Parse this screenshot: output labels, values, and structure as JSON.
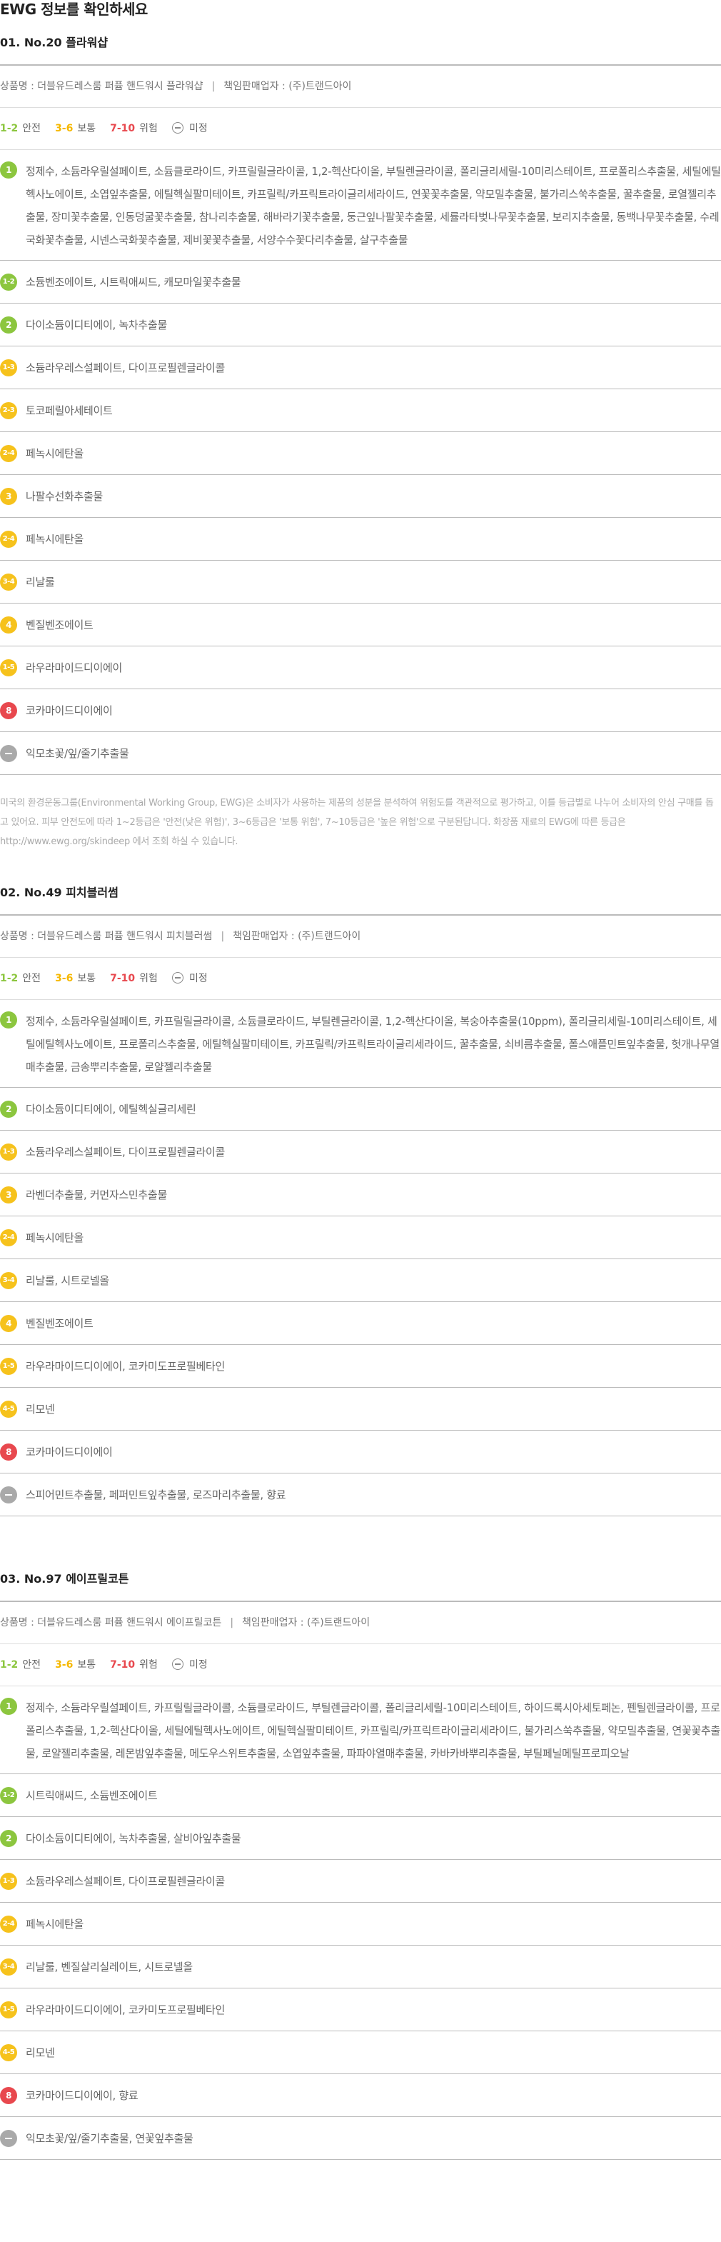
{
  "page": {
    "title": "EWG 정보를 확인하세요"
  },
  "legend": {
    "safe_range": "1-2",
    "safe_label": "안전",
    "normal_range": "3-6",
    "normal_label": "보통",
    "danger_range": "7-10",
    "danger_label": "위험",
    "unknown_label": "미정"
  },
  "colors": {
    "green": "#8cc63f",
    "yellow": "#f6c21c",
    "red": "#e8484e",
    "gray": "#a9a9a9"
  },
  "products": [
    {
      "title": "01. No.20 플라워샵",
      "product_name": "상품명 : 더블유드레스룸 퍼퓸 핸드워시 플라워샵",
      "seller": "책임판매업자 : (주)트랜드아이",
      "rows": [
        {
          "grade": "1",
          "color": "green",
          "text": "정제수, 소듐라우릴설페이트, 소듐클로라이드, 카프릴릴글라이콜, 1,2-헥산다이올, 부틸렌글라이콜, 폴리글리세릴-10미리스테이트, 프로폴리스추출물, 세틸에틸헥사노에이트, 소엽잎추출물, 에틸헥실팔미테이트, 카프릴릭/카프릭트라이글리세라이드, 연꽃꽃추출물, 약모밀추출물, 불가리스쑥추출물, 꿀추출물, 로열젤리추출물, 장미꽃추출물, 인동덩굴꽃추출물, 참나리추출물, 해바라기꽃추출물, 둥근잎나팔꽃추출물, 세률라타벚나무꽃추출물, 보리지추출물, 동백나무꽃추출물, 수레국화꽃추출물, 시넨스국화꽃추출물, 제비꽃꽃추출물, 서양수수꽃다리추출물, 살구추출물"
        },
        {
          "grade": "1-2",
          "color": "green",
          "text": "소듐벤조에이트, 시트릭애씨드, 캐모마일꽃추출물"
        },
        {
          "grade": "2",
          "color": "green",
          "text": "다이소듐이디티에이, 녹차추출물"
        },
        {
          "grade": "1-3",
          "color": "yellow",
          "text": "소듐라우레스설페이트, 다이프로필렌글라이콜"
        },
        {
          "grade": "2-3",
          "color": "yellow",
          "text": "토코페릴아세테이트"
        },
        {
          "grade": "2-4",
          "color": "yellow",
          "text": "페녹시에탄올"
        },
        {
          "grade": "3",
          "color": "yellow",
          "text": "나팔수선화추출물"
        },
        {
          "grade": "2-4",
          "color": "yellow",
          "text": "페녹시에탄올"
        },
        {
          "grade": "3-4",
          "color": "yellow",
          "text": "리날룰"
        },
        {
          "grade": "4",
          "color": "yellow",
          "text": "벤질벤조에이트"
        },
        {
          "grade": "1-5",
          "color": "yellow",
          "text": "라우라마이드디이에이"
        },
        {
          "grade": "8",
          "color": "red",
          "text": "코카마이드디이에이"
        },
        {
          "grade": "",
          "color": "gray",
          "text": "익모초꽃/잎/줄기추출물"
        }
      ],
      "note": "미국의 환경운동그룹(Environmental Working Group, EWG)은 소비자가 사용하는 제품의 성분을 분석하여 위험도를 객관적으로 평가하고, 이를 등급별로 나누어 소비자의 안심 구매를 돕고 있어요. 피부 안전도에 따라 1~2등급은 '안전(낮은 위험)', 3~6등급은 '보통 위험', 7~10등급은 '높은 위험'으로 구분된답니다. 화장품 재료의 EWG에 따른 등급은 http://www.ewg.org/skindeep 에서 조회 하실 수 있습니다."
    },
    {
      "title": "02. No.49 피치블러썸",
      "product_name": "상품명 : 더블유드레스룸 퍼퓸 핸드워시 피치블러썸",
      "seller": "책임판매업자 : (주)트랜드아이",
      "rows": [
        {
          "grade": "1",
          "color": "green",
          "text": "정제수, 소듐라우릴설페이트, 카프릴릴글라이콜, 소듐클로라이드, 부틸렌글라이콜, 1,2-헥산다이올, 복숭아추출물(10ppm), 폴리글리세릴-10미리스테이트, 세틸에틸헥사노에이트, 프로폴리스추출물, 에틸헥실팔미테이트, 카프릴릭/카프릭트라이글리세라이드, 꿀추출물, 쇠비름추출물, 폴스애플민트잎추출물, 헛개나무열매추출물, 금송뿌리추출물, 로얄젤리추출물"
        },
        {
          "grade": "2",
          "color": "green",
          "text": "다이소듐이디티에이, 에틸헥실글리세린"
        },
        {
          "grade": "1-3",
          "color": "yellow",
          "text": "소듐라우레스설페이트, 다이프로필렌글라이콜"
        },
        {
          "grade": "3",
          "color": "yellow",
          "text": "라벤더추출물, 커먼자스민추출물"
        },
        {
          "grade": "2-4",
          "color": "yellow",
          "text": "페녹시에탄올"
        },
        {
          "grade": "3-4",
          "color": "yellow",
          "text": "리날룰, 시트로넬올"
        },
        {
          "grade": "4",
          "color": "yellow",
          "text": "벤질벤조에이트"
        },
        {
          "grade": "1-5",
          "color": "yellow",
          "text": "라우라마이드디이에이, 코카미도프로필베타인"
        },
        {
          "grade": "4-5",
          "color": "yellow",
          "text": "리모넨"
        },
        {
          "grade": "8",
          "color": "red",
          "text": "코카마이드디이에이"
        },
        {
          "grade": "",
          "color": "gray",
          "text": "스피어민트추출물, 페퍼민트잎추출물, 로즈마리추출물, 향료"
        }
      ]
    },
    {
      "title": "03. No.97 에이프릴코튼",
      "product_name": "상품명 : 더블유드레스룸 퍼퓸 핸드워시 에이프릴코튼",
      "seller": "책임판매업자 : (주)트랜드아이",
      "rows": [
        {
          "grade": "1",
          "color": "green",
          "text": "정제수, 소듐라우릴설페이트, 카프릴릴글라이콜, 소듐클로라이드, 부틸렌글라이콜, 폴리글리세릴-10미리스테이트, 하이드록시아세토페논, 펜틸렌글라이콜, 프로폴리스추출물, 1,2-헥산다이올, 세틸에틸헥사노에이트, 에틸헥실팔미테이트, 카프릴릭/카프릭트라이글리세라이드, 불가리스쑥추출물, 약모밀추출물, 연꽃꽃추출물, 로얄젤리추출물, 레몬밤잎추출물, 메도우스위트추출물, 소엽잎추출물, 파파야열매추출물, 카바카바뿌리추출물, 부틸페닐메틸프로피오날"
        },
        {
          "grade": "1-2",
          "color": "green",
          "text": "시트릭애씨드, 소듐벤조에이트"
        },
        {
          "grade": "2",
          "color": "green",
          "text": "다이소듐이디티에이, 녹차추출물, 살비아잎추출물"
        },
        {
          "grade": "1-3",
          "color": "yellow",
          "text": "소듐라우레스설페이트, 다이프로필렌글라이콜"
        },
        {
          "grade": "2-4",
          "color": "yellow",
          "text": "페녹시에탄올"
        },
        {
          "grade": "3-4",
          "color": "yellow",
          "text": "리날룰, 벤질살리실레이트, 시트로넬올"
        },
        {
          "grade": "1-5",
          "color": "yellow",
          "text": "라우라마이드디이에이, 코카미도프로필베타인"
        },
        {
          "grade": "4-5",
          "color": "yellow",
          "text": "리모넨"
        },
        {
          "grade": "8",
          "color": "red",
          "text": "코카마이드디이에이, 향료"
        },
        {
          "grade": "",
          "color": "gray",
          "text": "익모초꽃/잎/줄기추출물, 연꽃잎추출물"
        }
      ]
    }
  ]
}
